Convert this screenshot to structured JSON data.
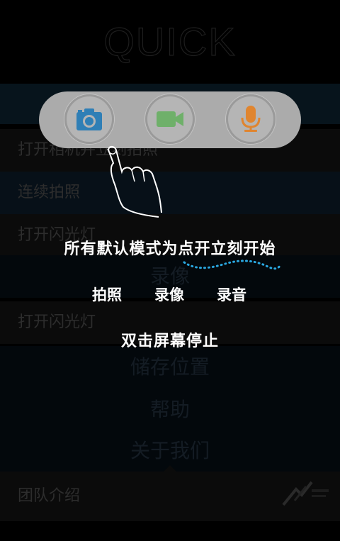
{
  "header": {
    "logo_text": "QUICK"
  },
  "menu": {
    "rows": [
      {
        "label": "打开相机并立刻拍照"
      },
      {
        "label": "连续拍照"
      },
      {
        "label": "打开闪光灯"
      },
      {
        "label": "打开闪光灯"
      }
    ],
    "sections": [
      {
        "label": "录像"
      },
      {
        "label": "储存位置"
      },
      {
        "label": "帮助"
      },
      {
        "label": "关于我们"
      }
    ],
    "bottom_label": "团队介绍"
  },
  "quick_bar": {
    "buttons": [
      {
        "name": "camera",
        "icon": "camera-icon",
        "color": "#2f7fb6"
      },
      {
        "name": "video",
        "icon": "video-camera-icon",
        "color": "#6fb06a"
      },
      {
        "name": "audio",
        "icon": "microphone-icon",
        "color": "#e0852f"
      }
    ]
  },
  "guide": {
    "main_tip": "所有默认模式为点开立刻开始",
    "modes": [
      "拍照",
      "录像",
      "录音"
    ],
    "stop_tip": "双击屏幕停止"
  },
  "colors": {
    "overlay_dots": "#2aa7e0",
    "pill": "#ababab"
  }
}
